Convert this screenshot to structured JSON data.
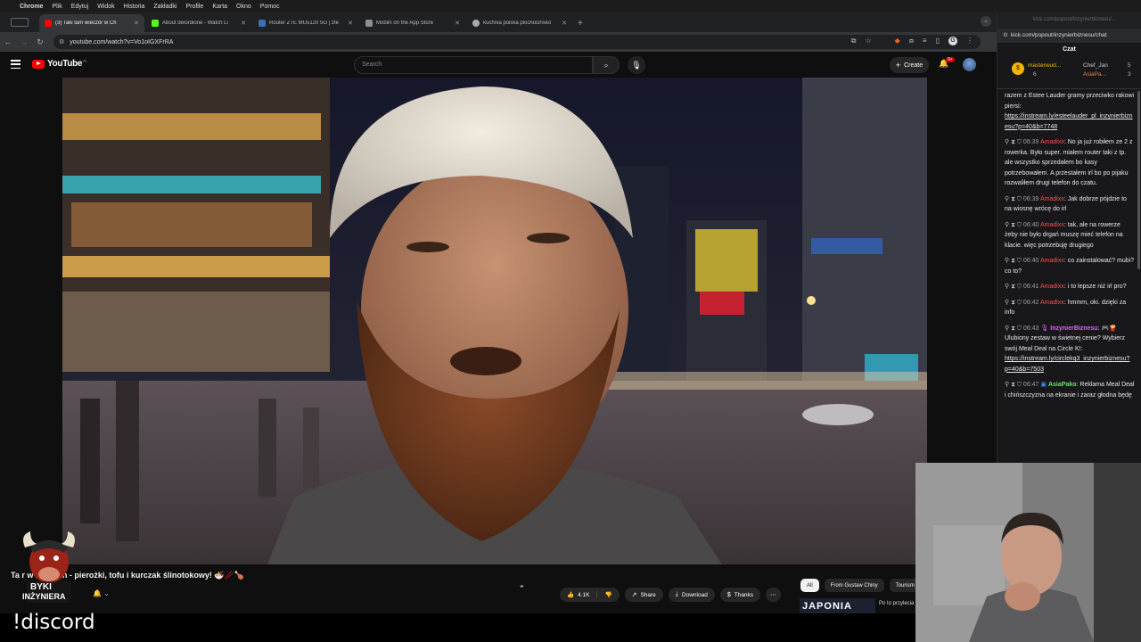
{
  "menubar": {
    "app": "Chrome",
    "items": [
      "Plik",
      "Edytuj",
      "Widok",
      "Historia",
      "Zakładki",
      "Profile",
      "Karta",
      "Okno",
      "Pomoc"
    ]
  },
  "tabs": [
    {
      "title": "(3) Taki tam wieczór w Ch",
      "color": "#ff0000",
      "active": true
    },
    {
      "title": "About delordione - Watch Li",
      "color": "#53fc18",
      "active": false
    },
    {
      "title": "Router ZTE MU5120 5G | zte",
      "color": "#3b6fb6",
      "active": false
    },
    {
      "title": "Mobiln on the App Store",
      "color": "#8e8e93",
      "active": false
    },
    {
      "title": "kuchnia polska plochocinsko",
      "color": "#aaaaaa",
      "active": false
    }
  ],
  "toolbar": {
    "url": "youtube.com/watch?v=Vo1oIGXFrRA"
  },
  "youtube": {
    "logo": "YouTube",
    "logo_sup": "PL",
    "search_placeholder": "Search",
    "create_label": "Create",
    "notif_count": "9+"
  },
  "video": {
    "title": "Taki tam wieczór w Chinach - pierożki, tofu i kurczak ślinotokowy! 🍜🥢🍗",
    "title_visible": "Ta                     r w Chinach - pierożki, tofu i kurczak ślinotokowy! 🍜🥢🍗",
    "overlay_logo_line1": "BYKI",
    "overlay_logo_line2": "INŻYNIERA"
  },
  "actions": {
    "like_count": "4.1K",
    "share": "Share",
    "download": "Download",
    "thanks": "Thanks"
  },
  "chips": [
    "All",
    "From Gustaw Chiny",
    "Tourism"
  ],
  "recommendation": {
    "thumb_text": "JAPONIA",
    "title": "Po to przylecia"
  },
  "stream_overlay": "!discord",
  "chat": {
    "titlebar": "kick.com/popout/inzynierbiznesu/...",
    "url": "kick.com/popout/inzynierbiznesu/chat",
    "header": "Czat",
    "leaders": [
      {
        "name": "masterwud...",
        "count": "6"
      },
      {
        "name": "Chef_Jan",
        "count": "5"
      },
      {
        "name": "AsiaPa...",
        "count": "3"
      }
    ],
    "messages": [
      {
        "type": "plain",
        "text": "razem z Estee Lauder gramy przeciwko rakowi piersi:",
        "link": "https://instream.ly/esteelauder_pl_inzynierbiznesu?p=40&b=7748"
      },
      {
        "type": "user",
        "time": "06:39",
        "user": "Amadixx",
        "text": "No ja już robiłem ze 2 z rowerka. Było super. miałem router taki z tp. ale wszystko sprzedałem bo kasy potrzebowałem. A przestałem irl bo po pijaku rozwaliłem drugi telefon do czatu."
      },
      {
        "type": "user",
        "time": "06:39",
        "user": "Amadixx",
        "text": "Jak dobrze pójdzie to na wiosnę wrócę do irl"
      },
      {
        "type": "user",
        "time": "06:40",
        "user": "Amadixx",
        "text": "tak, ale na rowerze żeby nie było drgań muszę mieć telefon na klacie. więc potrzebuję drugiego"
      },
      {
        "type": "user",
        "time": "06:40",
        "user": "Amadixx",
        "text": "co zainstalować? mubi? co to?"
      },
      {
        "type": "user",
        "time": "06:41",
        "user": "Amadixx",
        "text": "i to lepsze niż irl pro?"
      },
      {
        "type": "user",
        "time": "06:42",
        "user": "Amadixx",
        "text": "hmmm, oki. dzięki za info"
      },
      {
        "type": "bot",
        "time": "06:43",
        "user": "InzynierBiznesu",
        "text": "🎮🍟 Ulubiony zestaw w świetnej cenie? Wybierz swój Meal Deal na Circle K!:",
        "link": "https://instream.ly/circlekq3_inzynierbiznesu?p=40&b=7503"
      },
      {
        "type": "green",
        "time": "06:47",
        "user": "AsiaPako",
        "text": "Reklama Meal Deal i chińszczyzna na ekranie i zaraz głodna będę"
      }
    ]
  }
}
